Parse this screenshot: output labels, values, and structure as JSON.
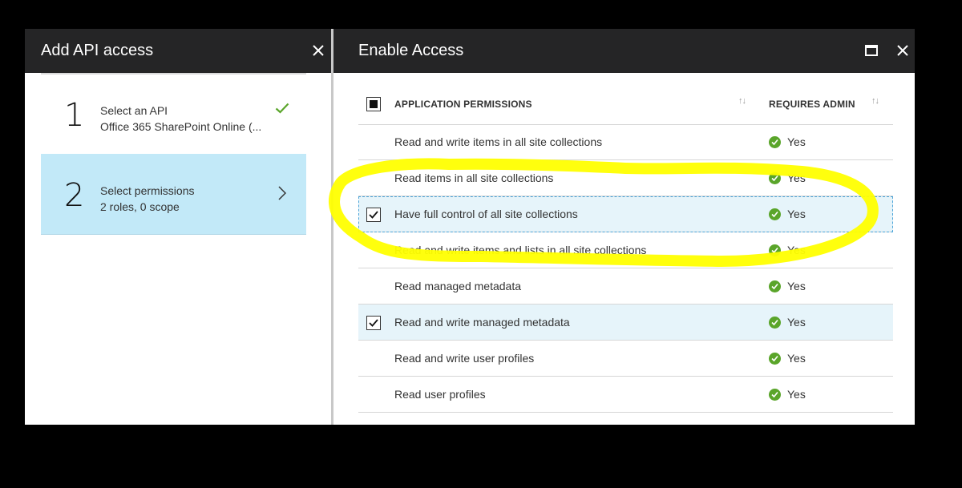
{
  "left_blade": {
    "title": "Add API access",
    "close_label": "✕",
    "steps": [
      {
        "number": "1",
        "title": "Select an API",
        "subtitle": "Office 365 SharePoint Online (...",
        "status": "completed",
        "icon": "checkmark-icon"
      },
      {
        "number": "2",
        "title": "Select permissions",
        "subtitle": "2 roles, 0 scope",
        "status": "active",
        "icon": "chevron-right-icon"
      }
    ]
  },
  "right_blade": {
    "title": "Enable Access",
    "maximize_icon": "maximize-icon",
    "close_icon": "close-icon",
    "table": {
      "header_checkbox": "partial",
      "col_permissions": "APPLICATION PERMISSIONS",
      "col_admin": "REQUIRES ADMIN",
      "sort_glyph": "↑↓",
      "rows": [
        {
          "label": "Read and write items in all site collections",
          "admin": "Yes",
          "checked": false
        },
        {
          "label": "Read items in all site collections",
          "admin": "Yes",
          "checked": false
        },
        {
          "label": "Have full control of all site collections",
          "admin": "Yes",
          "checked": true
        },
        {
          "label": "Read and write items and lists in all site collections",
          "admin": "Yes",
          "checked": false
        },
        {
          "label": "Read managed metadata",
          "admin": "Yes",
          "checked": false
        },
        {
          "label": "Read and write managed metadata",
          "admin": "Yes",
          "checked": true
        },
        {
          "label": "Read and write user profiles",
          "admin": "Yes",
          "checked": false
        },
        {
          "label": "Read user profiles",
          "admin": "Yes",
          "checked": false
        }
      ]
    }
  },
  "colors": {
    "header_bg": "#252526",
    "active_step_bg": "#c2e9f8",
    "selected_row_bg": "#e6f4fa",
    "success_green": "#5aa52a",
    "annotation_yellow": "#ffff00"
  }
}
